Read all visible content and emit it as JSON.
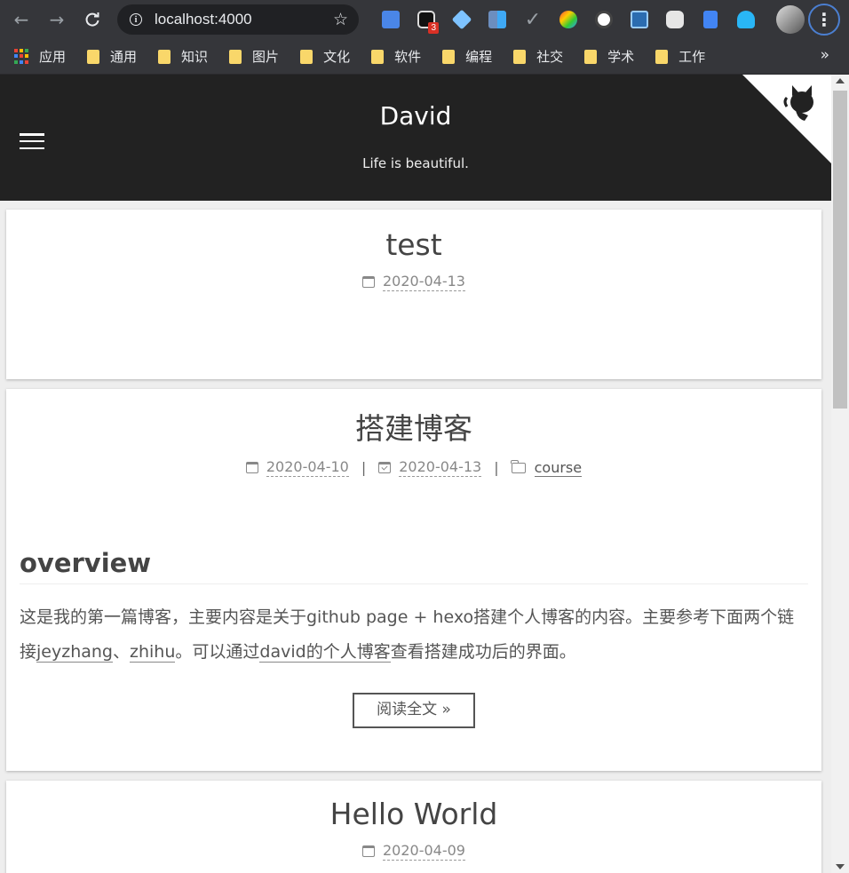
{
  "browser": {
    "url": "localhost:4000",
    "extension_badge": "3",
    "bookmarks": [
      {
        "label": "应用",
        "icon": "apps-icon"
      },
      {
        "label": "通用",
        "icon": "folder-icon"
      },
      {
        "label": "知识",
        "icon": "folder-icon"
      },
      {
        "label": "图片",
        "icon": "folder-icon"
      },
      {
        "label": "文化",
        "icon": "folder-icon"
      },
      {
        "label": "软件",
        "icon": "folder-icon"
      },
      {
        "label": "编程",
        "icon": "folder-icon"
      },
      {
        "label": "社交",
        "icon": "folder-icon"
      },
      {
        "label": "学术",
        "icon": "folder-icon"
      },
      {
        "label": "工作",
        "icon": "folder-icon"
      }
    ],
    "more_bookmarks": "»"
  },
  "site": {
    "title": "David",
    "subtitle": "Life is beautiful.",
    "header_bg": "#222222"
  },
  "posts": [
    {
      "title": "test",
      "created": "2020-04-13"
    },
    {
      "title": "搭建博客",
      "created": "2020-04-10",
      "updated": "2020-04-13",
      "category": "course",
      "sep": "|",
      "heading": "overview",
      "body": {
        "p1": "这是我的第一篇博客，主要内容是关于github page + hexo搭建个人博客的内容。主要参考下面两个链接",
        "link1": "jeyzhang",
        "p2": "、",
        "link2": "zhihu",
        "p3": "。可以通过",
        "link3": "david的个人博客",
        "p4": "查看搭建成功后的界面。"
      },
      "read_more": "阅读全文 »"
    },
    {
      "title": "Hello World",
      "created": "2020-04-09"
    }
  ]
}
